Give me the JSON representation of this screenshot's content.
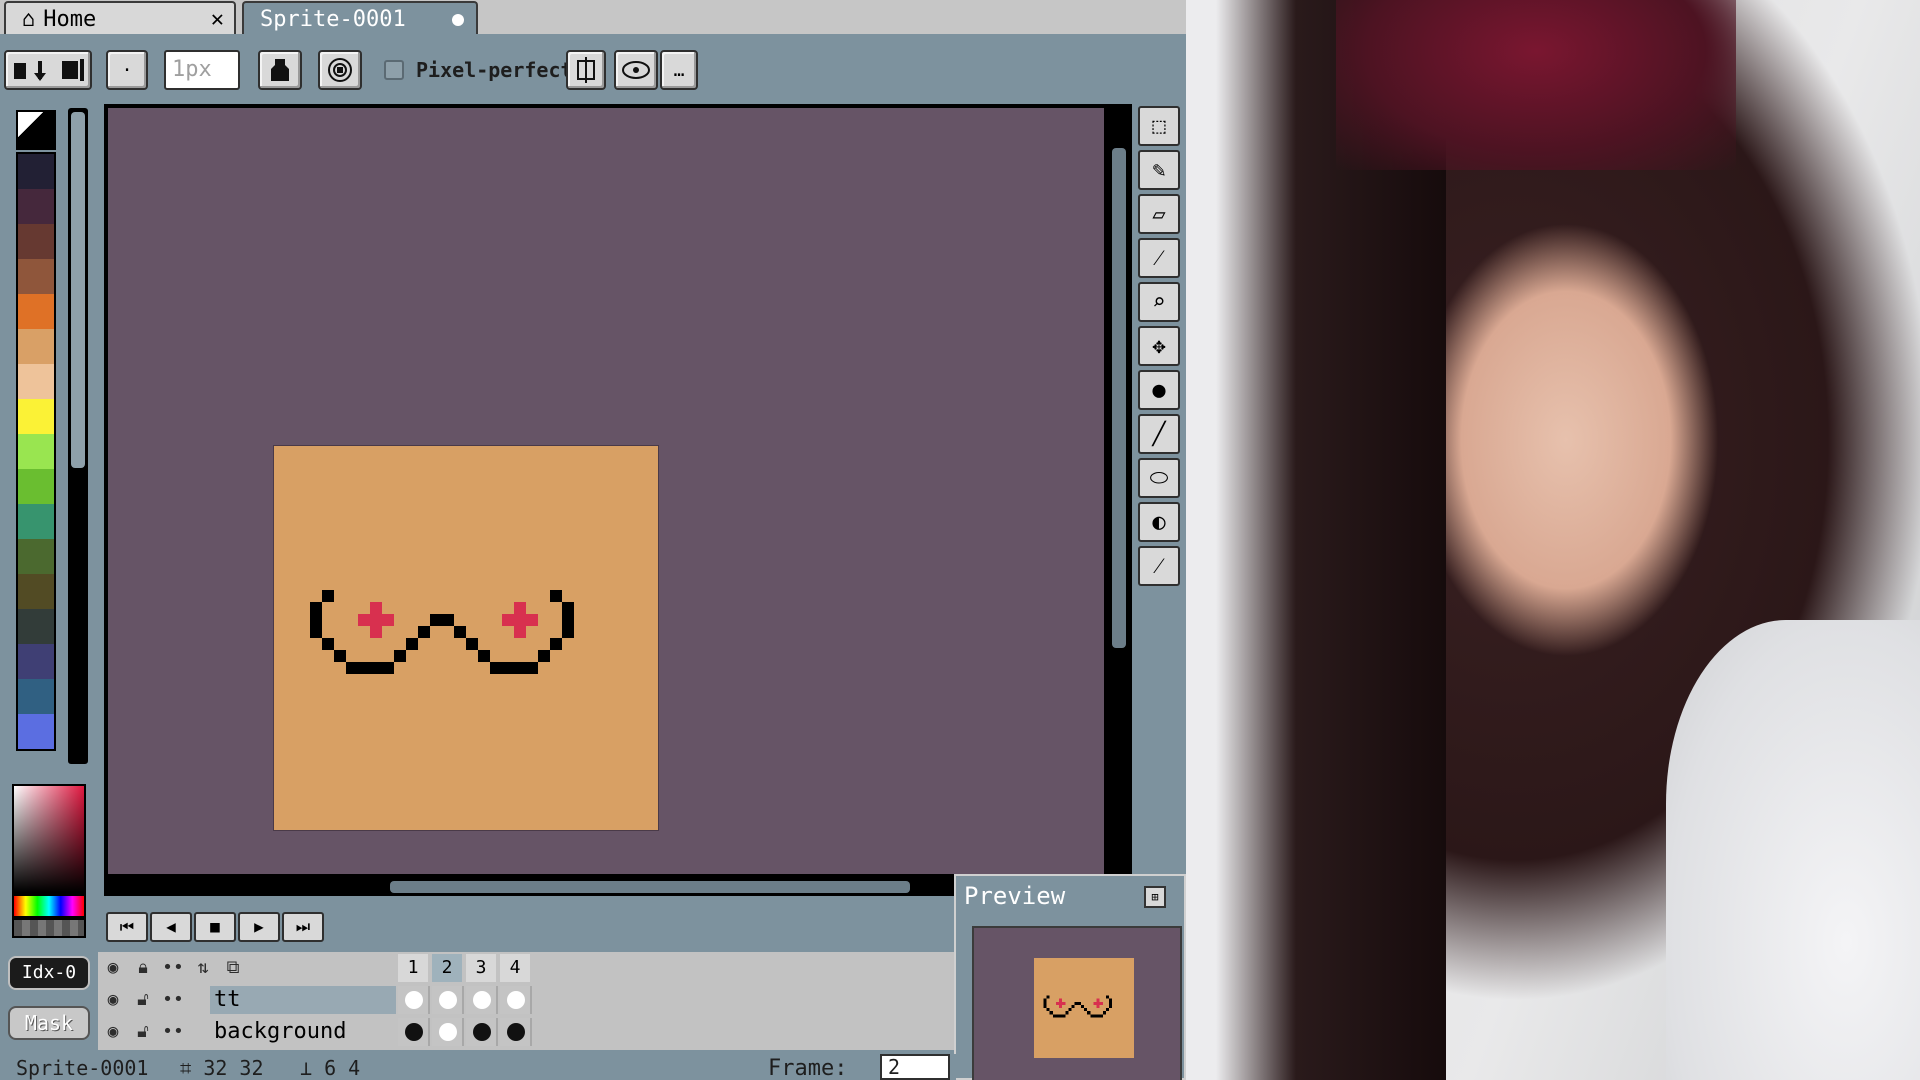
{
  "tabs": {
    "home": "Home",
    "sprite": "Sprite-0001",
    "close_glyph": "✕"
  },
  "context_bar": {
    "brush_size": "1px",
    "pixel_perfect_label": "Pixel-perfect"
  },
  "palette": {
    "colors": [
      "#222034",
      "#45283c",
      "#663931",
      "#8f563b",
      "#df7126",
      "#d9a066",
      "#eec39a",
      "#fbf236",
      "#99e550",
      "#6abe30",
      "#37946e",
      "#4b692f",
      "#524b24",
      "#323c39",
      "#3f3f74",
      "#306082",
      "#5b6ee1"
    ]
  },
  "color_panel": {
    "index_label": "Idx-0",
    "mask_label": "Mask"
  },
  "timeline": {
    "frames": [
      "1",
      "2",
      "3",
      "4"
    ],
    "active_frame": "2",
    "layers": [
      {
        "name": "tt"
      },
      {
        "name": "background"
      }
    ]
  },
  "preview": {
    "title": "Preview"
  },
  "status": {
    "sprite_name": "Sprite-0001",
    "size": "32 32",
    "position": "6 4",
    "frame_label": "Frame:",
    "frame_value": "2"
  },
  "colors": {
    "ui_bg": "#7d929e",
    "canvas_bg": "#665466",
    "sprite_fill": "#d8a064",
    "accent_pink": "#d8304f"
  }
}
